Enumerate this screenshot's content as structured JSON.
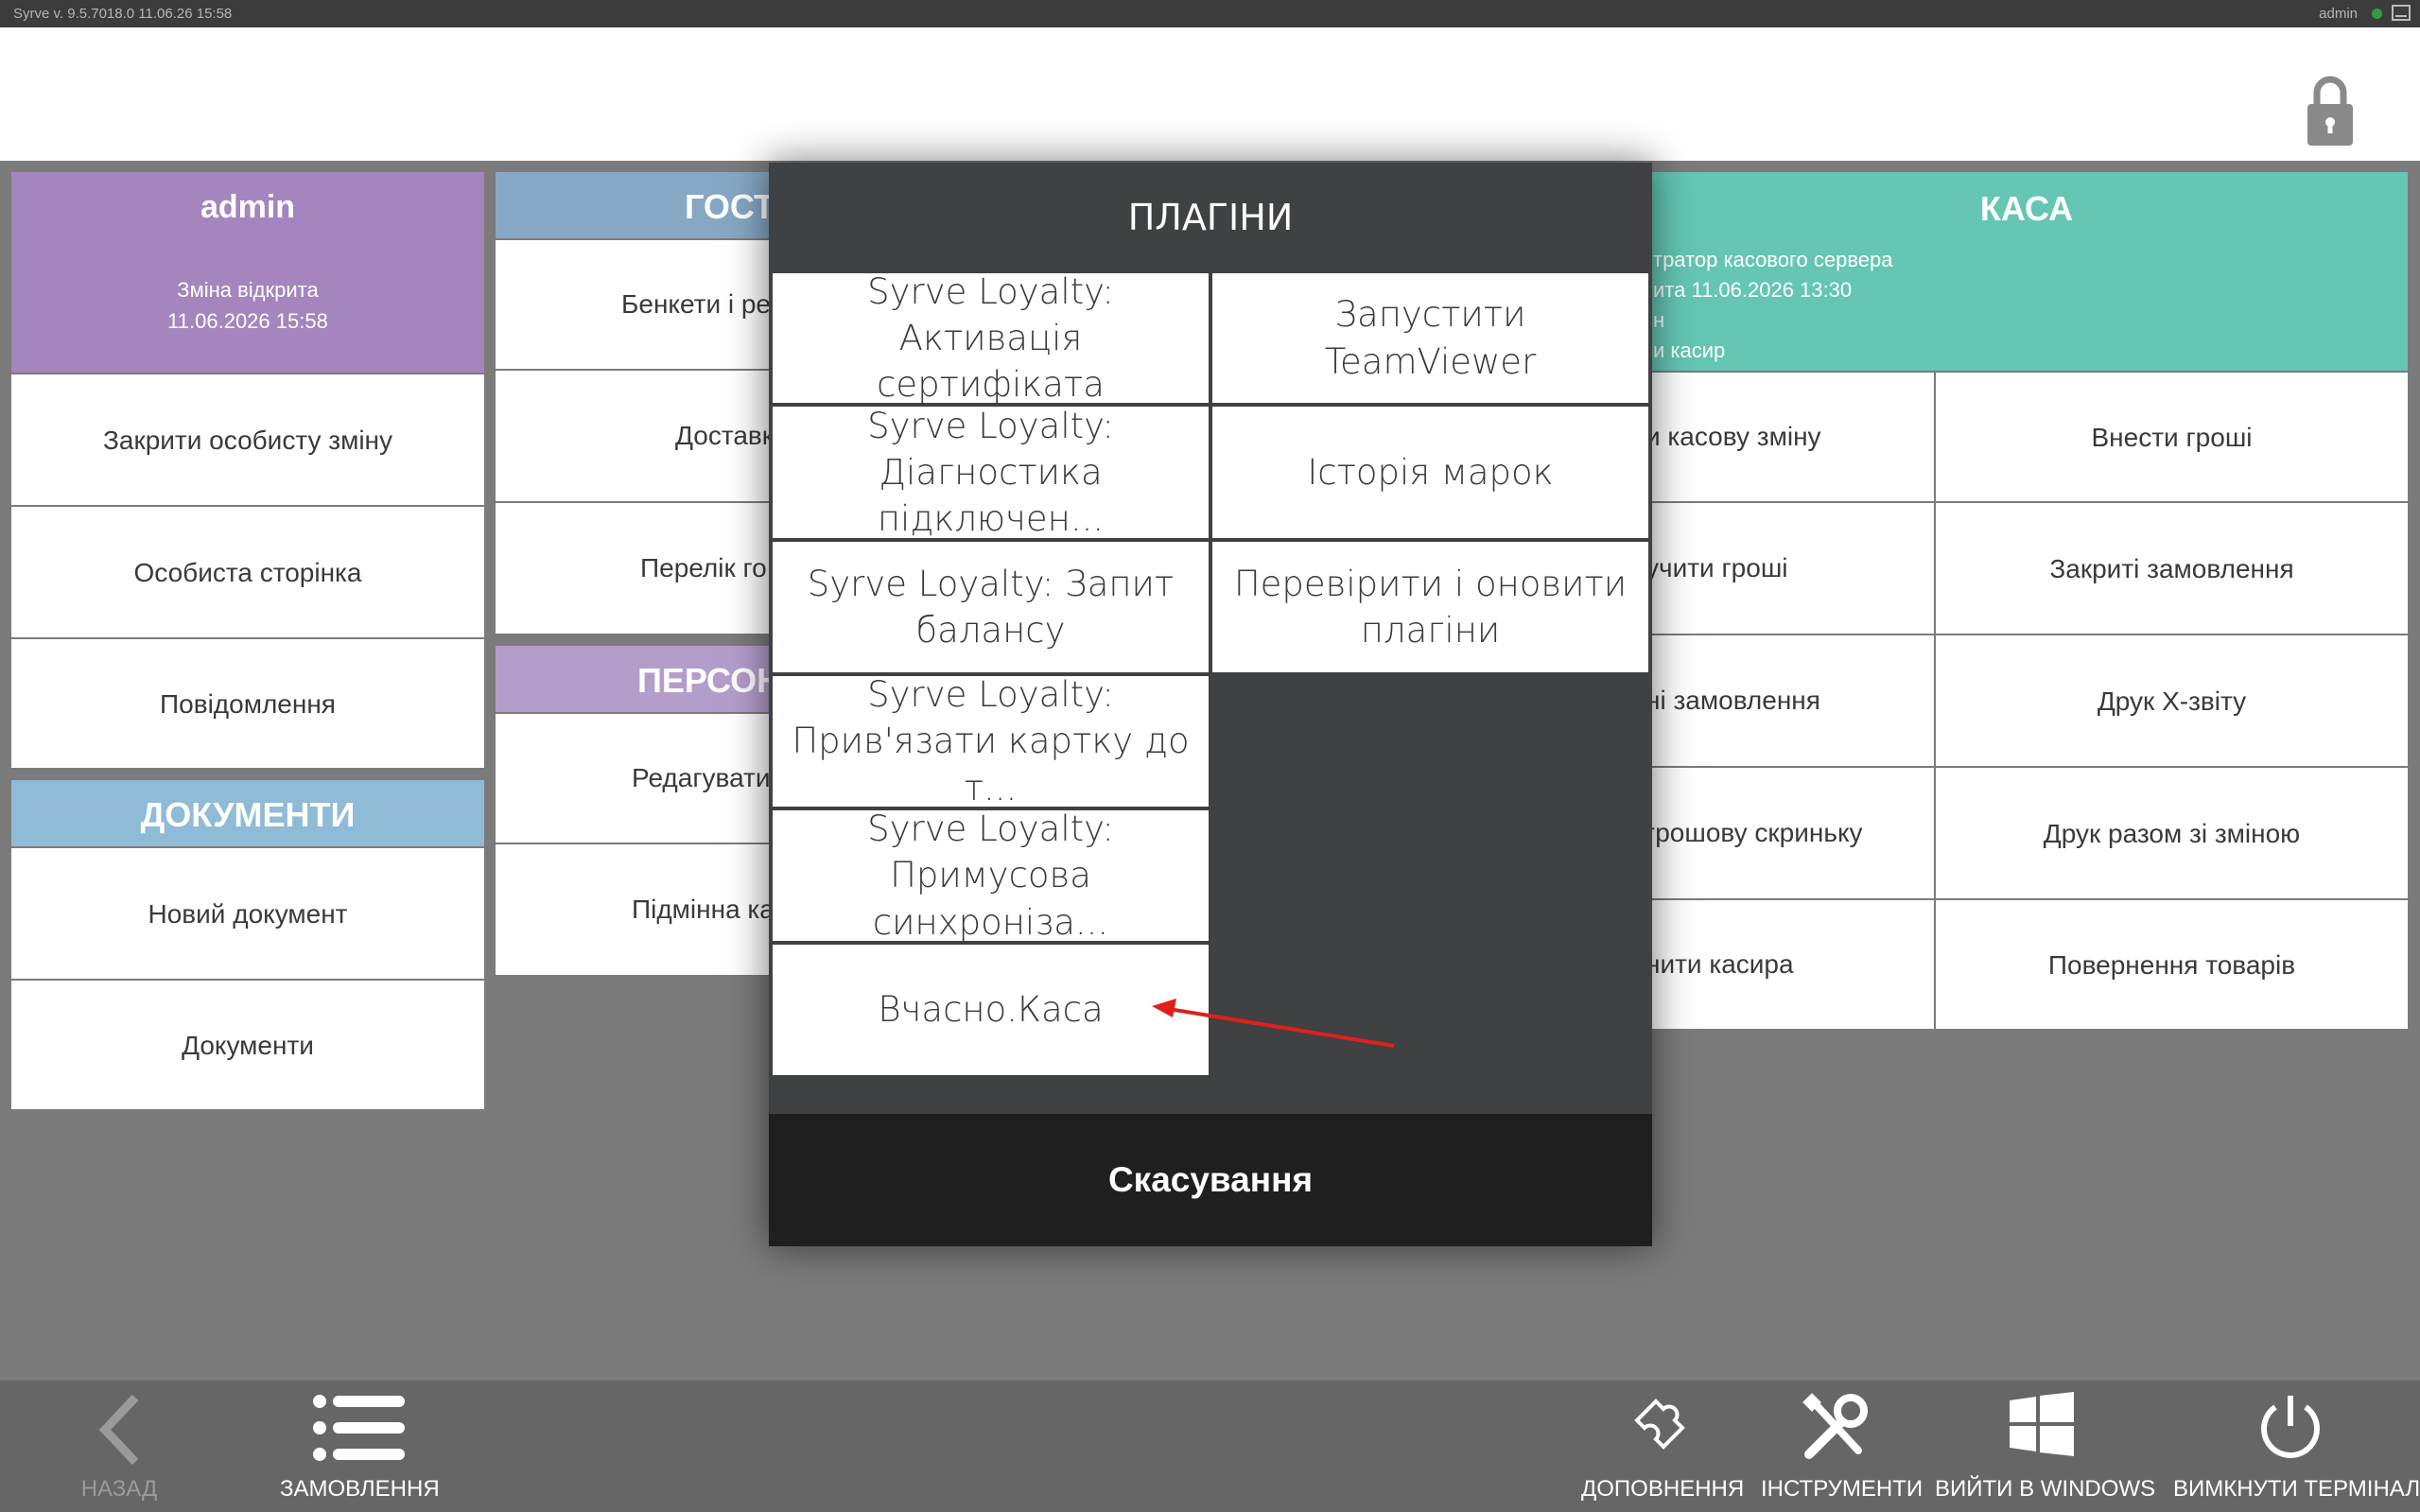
{
  "status_bar": {
    "version": "Syrve  v. 9.5.7018.0      11.06.26   15:58",
    "user": "admin"
  },
  "user_panel": {
    "title": "admin",
    "shift_status": "Зміна відкрита",
    "shift_datetime": "11.06.2026 15:58",
    "items": [
      "Закрити особисту зміну",
      "Особиста сторінка",
      "Повідомлення"
    ]
  },
  "documents_panel": {
    "title": "ДОКУМЕНТИ",
    "items": [
      "Новий документ",
      "Документи"
    ]
  },
  "guests_panel": {
    "title": "ГОСТ",
    "items": [
      "Бенкети і ре",
      "Доставк",
      "Перелік го"
    ]
  },
  "staff_panel": {
    "title": "ПЕРСОН",
    "items": [
      "Редагувати",
      "Підмінна ка"
    ]
  },
  "cash_panel": {
    "title": "КАСА",
    "info_lines": [
      "тратор касового сервера",
      "ита 11.06.2026 13:30",
      "н",
      "и касир"
    ],
    "left_items": [
      "и касову зміну",
      "учити гроші",
      "ні замовлення",
      "грошову скриньку",
      "нити касира"
    ],
    "right_items": [
      "Внести гроші",
      "Закриті замовлення",
      "Друк Х-звіту",
      "Друк разом зі зміною",
      "Повернення товарів"
    ]
  },
  "plugins_dialog": {
    "title": "ПЛАГІНИ",
    "left_buttons": [
      [
        "Syrve Loyalty: Активація",
        "сертифіката"
      ],
      [
        "Syrve Loyalty:",
        "Діагностика підключен..."
      ],
      [
        "Syrve Loyalty: Запит",
        "балансу"
      ],
      [
        "Syrve Loyalty:",
        "Прив'язати картку до т..."
      ],
      [
        "Syrve Loyalty:",
        "Примусова синхроніза..."
      ],
      [
        "Вчасно.Каса"
      ]
    ],
    "right_buttons": [
      [
        "Запустити TeamViewer"
      ],
      [
        "Історія марок"
      ],
      [
        "Перевірити і оновити",
        "плагіни"
      ]
    ],
    "cancel_label": "Скасування"
  },
  "bottom_bar": {
    "back": "НАЗАД",
    "orders": "ЗАМОВЛЕННЯ",
    "addons": "ДОПОВНЕННЯ",
    "tools": "ІНСТРУМЕНТИ",
    "exit_windows": "ВИЙТИ В WINDOWS",
    "shutdown": "ВИМКНУТИ ТЕРМІНАЛ"
  },
  "colors": {
    "user_header": "#a585bd",
    "documents_header": "#8fbbd6",
    "guests_header": "#86a8c4",
    "staff_header": "#b59dcb",
    "cash_header": "#64c6b3",
    "dialog_bg": "#3f4142",
    "annotation_arrow": "#e0201c"
  }
}
